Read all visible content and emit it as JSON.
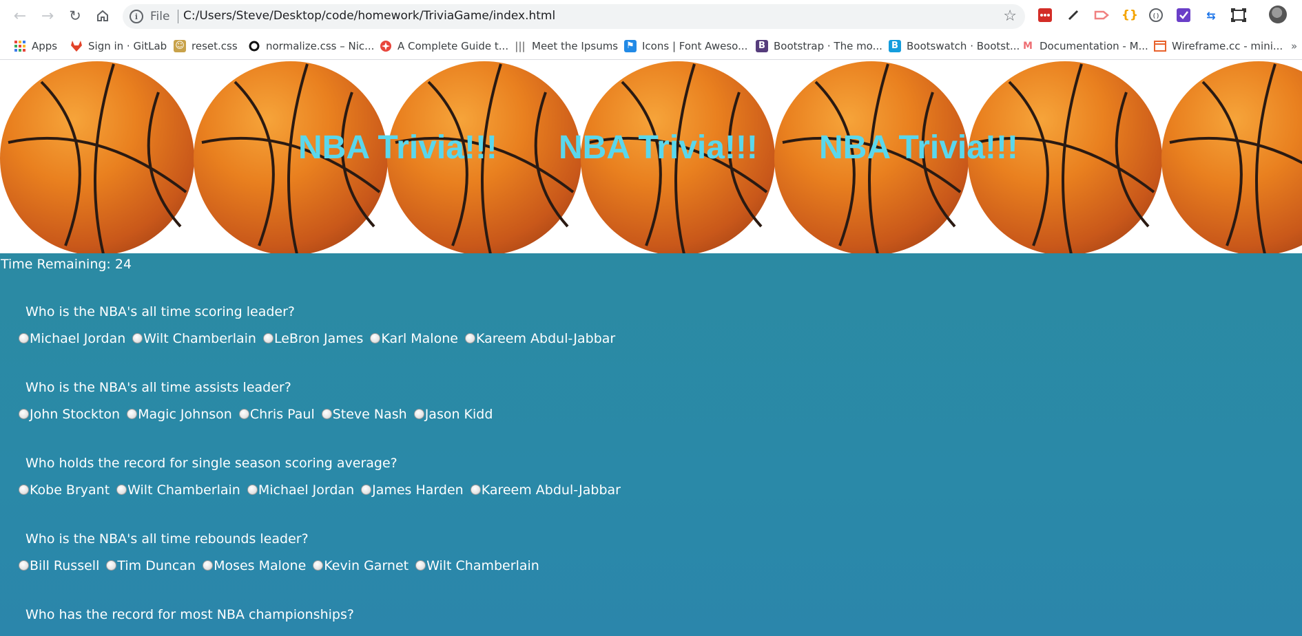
{
  "browser": {
    "scheme_label": "File",
    "url": "C:/Users/Steve/Desktop/code/homework/TriviaGame/index.html",
    "bookmarks": [
      {
        "label": "Apps",
        "icon": "apps-grid-icon",
        "color": "#e8453c"
      },
      {
        "label": "Sign in · GitLab",
        "icon": "gitlab-icon",
        "color": "#e24329"
      },
      {
        "label": "reset.css",
        "icon": "reset-css-icon",
        "color": "#c8a24a"
      },
      {
        "label": "normalize.css – Nic...",
        "icon": "normalize-icon",
        "color": "#111111"
      },
      {
        "label": "A Complete Guide t...",
        "icon": "css-tricks-icon",
        "color": "#e8453c"
      },
      {
        "label": "Meet the Ipsums",
        "icon": "ipsums-icon",
        "color": "#555555"
      },
      {
        "label": "Icons | Font Aweso...",
        "icon": "font-awesome-icon",
        "color": "#228ae6"
      },
      {
        "label": "Bootstrap · The mo...",
        "icon": "bootstrap-icon",
        "color": "#563d7c"
      },
      {
        "label": "Bootswatch · Bootst...",
        "icon": "bootswatch-icon",
        "color": "#149ddd"
      },
      {
        "label": "Documentation - M...",
        "icon": "materialize-icon",
        "color": "#ee6e73"
      },
      {
        "label": "Wireframe.cc - mini...",
        "icon": "wireframe-icon",
        "color": "#e8622c"
      }
    ]
  },
  "banner": {
    "title": "NBA Trivia!!!"
  },
  "timer": {
    "text": "Time Remaining: 24"
  },
  "questions": [
    {
      "question": "Who is the NBA's all time scoring leader?",
      "answers": [
        "Michael Jordan",
        "Wilt Chamberlain",
        "LeBron James",
        "Karl Malone",
        "Kareem Abdul-Jabbar"
      ]
    },
    {
      "question": "Who is the NBA's all time assists leader?",
      "answers": [
        "John Stockton",
        "Magic Johnson",
        "Chris Paul",
        "Steve Nash",
        "Jason Kidd"
      ]
    },
    {
      "question": "Who holds the record for single season scoring average?",
      "answers": [
        "Kobe Bryant",
        "Wilt Chamberlain",
        "Michael Jordan",
        "James Harden",
        "Kareem Abdul-Jabbar"
      ]
    },
    {
      "question": "Who is the NBA's all time rebounds leader?",
      "answers": [
        "Bill Russell",
        "Tim Duncan",
        "Moses Malone",
        "Kevin Garnet",
        "Wilt Chamberlain"
      ]
    },
    {
      "question": "Who has the record for most NBA championships?",
      "answers": []
    }
  ]
}
